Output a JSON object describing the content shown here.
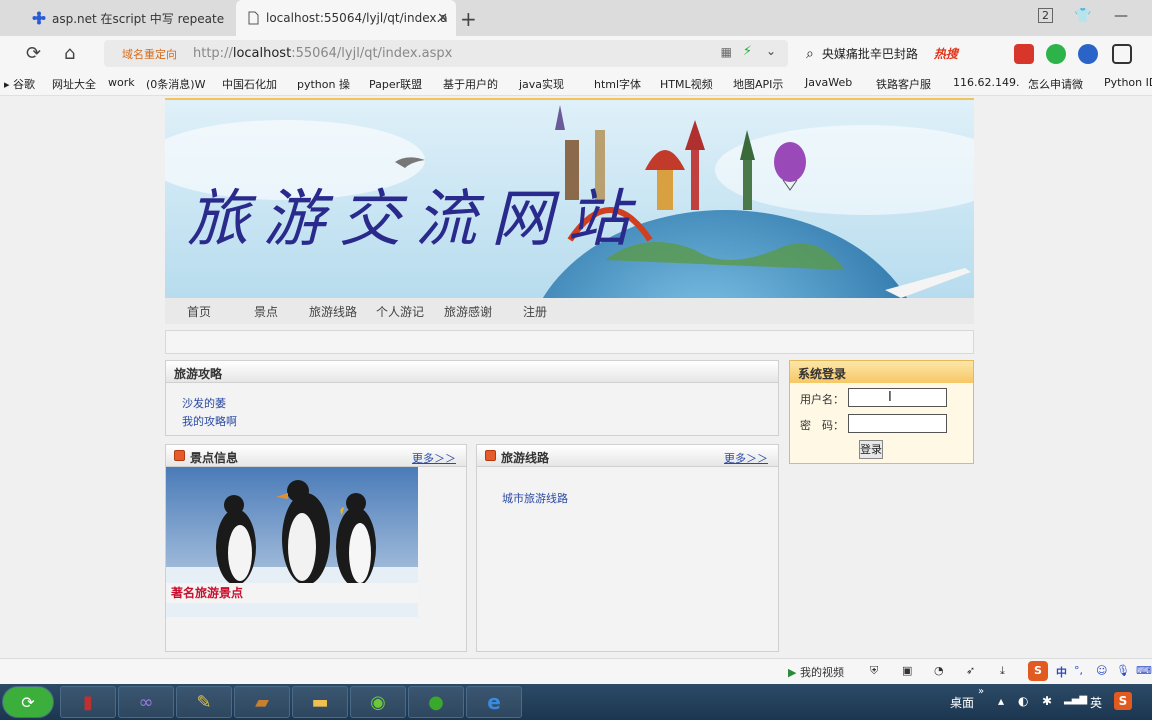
{
  "browser": {
    "tabs": [
      {
        "label": "asp.net 在script 中写 repeate"
      },
      {
        "label": "localhost:55064/lyjl/qt/index.a"
      }
    ],
    "window_count": "2",
    "address": {
      "tag": "域名重定向",
      "url_prefix": "http://",
      "url_host": "localhost",
      "url_rest": ":55064/lyjl/qt/index.aspx"
    },
    "search": {
      "text": "央媒痛批辛巴封路",
      "hot_label": "热搜"
    },
    "bookmarks": [
      "谷歌",
      "网址大全",
      "work",
      "(0条消息)W",
      "中国石化加",
      "python 操",
      "Paper联盟",
      "基于用户的",
      "java实现",
      "html字体",
      "HTML视频",
      "地图API示",
      "JavaWeb",
      "铁路客户服",
      "116.62.149.",
      "怎么申请微",
      "Python ID"
    ]
  },
  "site": {
    "banner_title": "旅游交流网站",
    "menu": [
      "首页",
      "景点",
      "旅游线路",
      "个人游记",
      "旅游感谢",
      "注册"
    ],
    "guide": {
      "title": "旅游攻略",
      "links": [
        "沙发的萎",
        "我的攻略啊"
      ]
    },
    "scenic": {
      "title": "景点信息",
      "more": "更多＞＞",
      "caption": "著名旅游景点"
    },
    "routes": {
      "title": "旅游线路",
      "more": "更多＞＞",
      "links": [
        "城市旅游线路"
      ]
    },
    "login": {
      "title": "系统登录",
      "username_label": "用户名：",
      "password_label": "密　码：",
      "username_value": "",
      "password_value": "",
      "submit": "登录"
    }
  },
  "statusbar": {
    "video": "我的视频",
    "ime_lang": "中",
    "ime_mode": "英"
  },
  "taskbar": {
    "desktop": "桌面"
  }
}
